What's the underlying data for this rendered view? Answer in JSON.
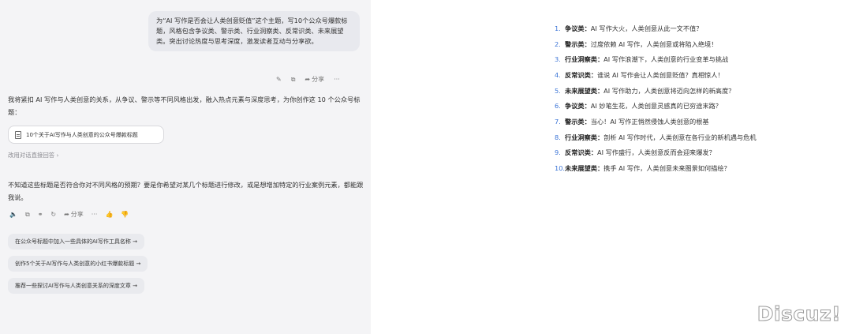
{
  "conversation": {
    "user_message": "为“AI 写作是否会让人类创意贬值”这个主题，写10个公众号爆款标题，风格包含争议类、警示类、行业洞察类、反常识类、未来展望类。突出讨论热度与思考深度，激发读者互动与分享欲。",
    "user_actions": {
      "edit_icon": "✎",
      "copy_icon": "⧉",
      "share_icon": "➦",
      "share_label": "分享",
      "more_icon": "···"
    },
    "reply_intro": "我将紧扣 AI 写作与人类创意的关系，从争议、警示等不同风格出发，融入热点元素与深度思考，为你创作这 10 个公众号标题：",
    "doc_card_label": "10个关于AI写作与人类创意的公众号爆款标题",
    "direct_reply_label": "改用对话直接回答 ›",
    "reply_question": "不知道这些标题是否符合你对不同风格的预期？要是你希望对某几个标题进行修改，或是想增加特定的行业案例元素，都能跟我说。",
    "reply_actions": {
      "speaker_icon": "🔈",
      "copy_icon": "⧉",
      "link_icon": "⚭",
      "regen_icon": "↻",
      "share_icon": "➦",
      "share_label": "分享",
      "more_icon": "···",
      "like_icon": "👍",
      "dislike_icon": "👎"
    },
    "suggestions": [
      "在公众号标题中加入一些具体的AI写作工具名称 →",
      "创作5个关于AI写作与人类创意的小红书爆款标题 →",
      "推荐一些探讨AI写作与人类创意关系的深度文章 →"
    ]
  },
  "document": {
    "titles": [
      {
        "num": "1.",
        "category": "争议类",
        "text": "AI 写作大火，人类创意从此一文不值？"
      },
      {
        "num": "2.",
        "category": "警示类",
        "text": "过度依赖 AI 写作，人类创意或将陷入绝境！"
      },
      {
        "num": "3.",
        "category": "行业洞察类",
        "text": "AI 写作浪潮下，人类创意的行业变革与挑战"
      },
      {
        "num": "4.",
        "category": "反常识类",
        "text": "谁说 AI 写作会让人类创意贬值？真相惊人！"
      },
      {
        "num": "5.",
        "category": "未来展望类",
        "text": "AI 写作助力，人类创意将迈向怎样的新高度？"
      },
      {
        "num": "6.",
        "category": "争议类",
        "text": "AI 妙笔生花，人类创意灵感真的已穷途末路？"
      },
      {
        "num": "7.",
        "category": "警示类",
        "text": "当心！AI 写作正悄然侵蚀人类创意的根基"
      },
      {
        "num": "8.",
        "category": "行业洞察类",
        "text": "剖析 AI 写作时代，人类创意在各行业的新机遇与危机"
      },
      {
        "num": "9.",
        "category": "反常识类",
        "text": "AI 写作盛行，人类创意反而会迎来爆发？"
      },
      {
        "num": "10.",
        "category": "未来展望类",
        "text": "携手 AI 写作，人类创意未来图景如何描绘？"
      }
    ],
    "separator": "："
  },
  "watermark": "Discuz!"
}
